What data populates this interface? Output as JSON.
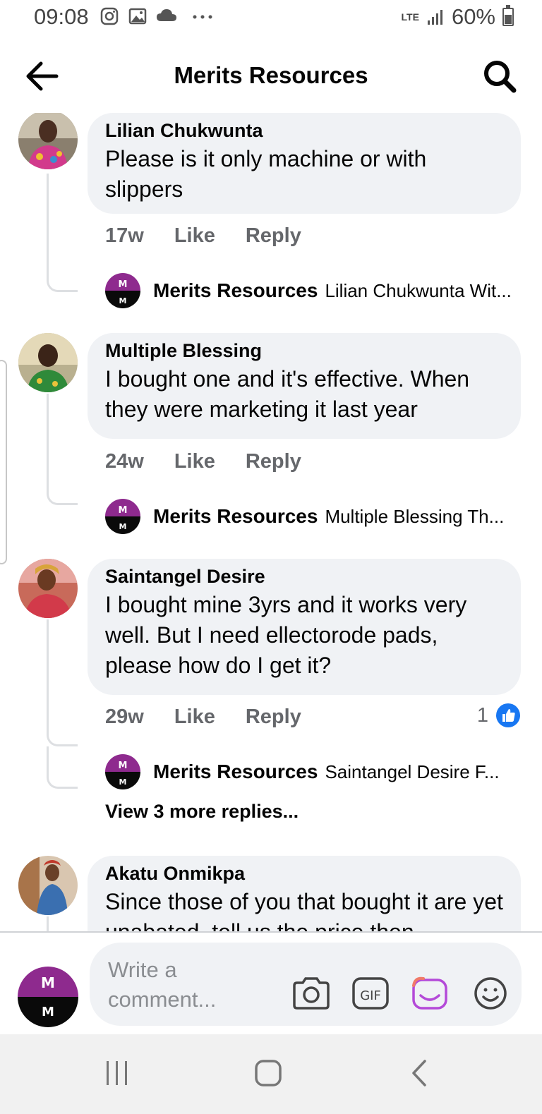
{
  "status_bar": {
    "time": "09:08",
    "network": "LTE",
    "battery": "60%"
  },
  "header": {
    "title": "Merits Resources"
  },
  "comments": [
    {
      "author": "Lilian Chukwunta",
      "text": "Please is it only machine or with slippers",
      "time": "17w",
      "like_label": "Like",
      "reply_label": "Reply",
      "reply": {
        "author": "Merits Resources",
        "preview": "Lilian Chukwunta Wit..."
      }
    },
    {
      "author": "Multiple Blessing",
      "text": "I bought one and it's effective. When they were marketing it last year",
      "time": "24w",
      "like_label": "Like",
      "reply_label": "Reply",
      "reply": {
        "author": "Merits Resources",
        "preview": "Multiple Blessing Th..."
      }
    },
    {
      "author": "Saintangel Desire",
      "text": "I bought mine 3yrs and it works very well. But I need ellectorode pads, please how do I get it?",
      "time": "29w",
      "like_label": "Like",
      "reply_label": "Reply",
      "reactions": "1",
      "reply": {
        "author": "Merits Resources",
        "preview": "Saintangel Desire  F..."
      },
      "view_more": "View 3 more replies..."
    },
    {
      "author": "Akatu Onmikpa",
      "text": "Since those of you that bought it are yet unabated, tell us the price then"
    }
  ],
  "composer": {
    "placeholder": "Write a comment..."
  },
  "colors": {
    "bubble": "#f0f2f5",
    "secondary_text": "#65676b",
    "like_blue": "#1877f2",
    "brand_purple": "#8e2a8e"
  }
}
